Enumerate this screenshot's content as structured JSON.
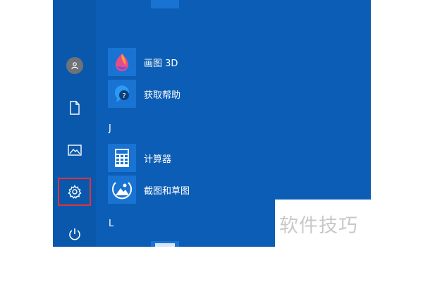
{
  "rail": {
    "buttons": [
      {
        "name": "user-account",
        "icon": "user-icon"
      },
      {
        "name": "documents",
        "icon": "document-icon"
      },
      {
        "name": "pictures",
        "icon": "picture-icon"
      },
      {
        "name": "settings",
        "icon": "gear-icon",
        "highlighted": true
      },
      {
        "name": "power",
        "icon": "power-icon"
      }
    ],
    "highlight_color": "#e0323c"
  },
  "app_list": {
    "sections": [
      {
        "letter": "J",
        "apps": [
          {
            "label": "计算器",
            "icon": "calculator-icon"
          },
          {
            "label": "截图和草图",
            "icon": "snip-sketch-icon"
          }
        ]
      },
      {
        "letter": "L",
        "apps": []
      }
    ],
    "apps_above": [
      {
        "label": "画图 3D",
        "icon": "paint3d-icon"
      },
      {
        "label": "获取帮助",
        "icon": "get-help-icon"
      }
    ]
  },
  "colors": {
    "start_bg": "#0c5db5",
    "tile_bg": "#1973d2"
  },
  "watermark": {
    "text": "软件技巧"
  }
}
